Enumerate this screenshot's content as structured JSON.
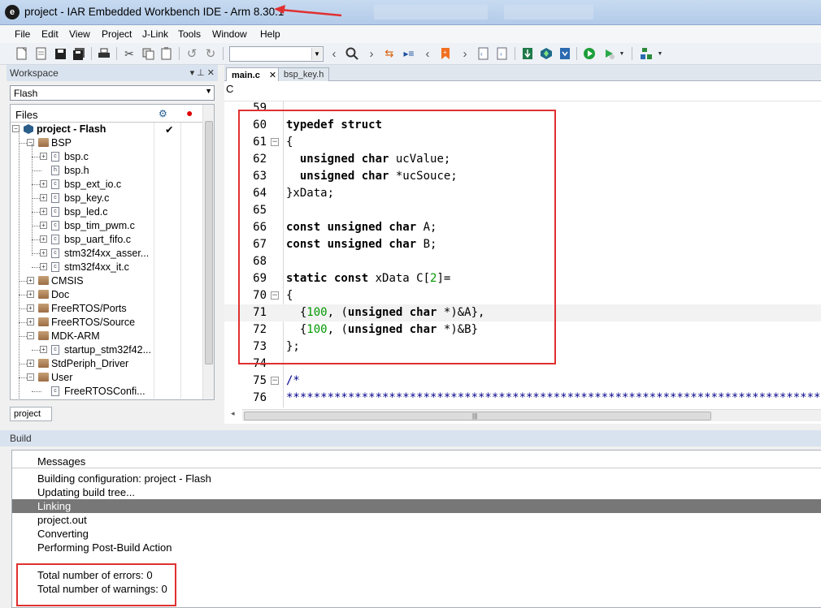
{
  "window": {
    "title": "project - IAR Embedded Workbench IDE - Arm 8.30.1",
    "icon_letter": "e"
  },
  "menu": [
    "File",
    "Edit",
    "View",
    "Project",
    "J-Link",
    "Tools",
    "Window",
    "Help"
  ],
  "toolbar": {
    "icons": [
      "new-file",
      "open",
      "save",
      "save-all",
      "print",
      "cut",
      "copy",
      "paste",
      "undo",
      "redo",
      "find",
      "bookmark",
      "compile",
      "make",
      "debug",
      "run"
    ],
    "search_value": ""
  },
  "workspace": {
    "title": "Workspace",
    "header_icons": "▾ ⊥ ✕",
    "configuration": "Flash",
    "files_header": "Files",
    "tab": "project",
    "tree": [
      {
        "label": "project - Flash",
        "level": 0,
        "kind": "project",
        "bold": true,
        "check": "✔"
      },
      {
        "label": "BSP",
        "level": 1,
        "kind": "folder",
        "exp": "−"
      },
      {
        "label": "bsp.c",
        "level": 2,
        "kind": "file",
        "exp": "+"
      },
      {
        "label": "bsp.h",
        "level": 2,
        "kind": "file",
        "exp": ""
      },
      {
        "label": "bsp_ext_io.c",
        "level": 2,
        "kind": "file",
        "exp": "+"
      },
      {
        "label": "bsp_key.c",
        "level": 2,
        "kind": "file",
        "exp": "+"
      },
      {
        "label": "bsp_led.c",
        "level": 2,
        "kind": "file",
        "exp": "+"
      },
      {
        "label": "bsp_tim_pwm.c",
        "level": 2,
        "kind": "file",
        "exp": "+"
      },
      {
        "label": "bsp_uart_fifo.c",
        "level": 2,
        "kind": "file",
        "exp": "+"
      },
      {
        "label": "stm32f4xx_asser...",
        "level": 2,
        "kind": "file",
        "exp": "+"
      },
      {
        "label": "stm32f4xx_it.c",
        "level": 2,
        "kind": "file",
        "exp": "+"
      },
      {
        "label": "CMSIS",
        "level": 1,
        "kind": "folder",
        "exp": "+"
      },
      {
        "label": "Doc",
        "level": 1,
        "kind": "folder",
        "exp": "+"
      },
      {
        "label": "FreeRTOS/Ports",
        "level": 1,
        "kind": "folder",
        "exp": "+"
      },
      {
        "label": "FreeRTOS/Source",
        "level": 1,
        "kind": "folder",
        "exp": "+"
      },
      {
        "label": "MDK-ARM",
        "level": 1,
        "kind": "folder",
        "exp": "−"
      },
      {
        "label": "startup_stm32f42...",
        "level": 2,
        "kind": "file",
        "exp": "+"
      },
      {
        "label": "StdPeriph_Driver",
        "level": 1,
        "kind": "folder",
        "exp": "+"
      },
      {
        "label": "User",
        "level": 1,
        "kind": "folder",
        "exp": "−"
      },
      {
        "label": "FreeRTOSConfi...",
        "level": 2,
        "kind": "file",
        "exp": ""
      }
    ]
  },
  "editor": {
    "tabs": [
      {
        "label": "main.c",
        "close": "✕"
      },
      {
        "label": "bsp_key.h",
        "close": ""
      }
    ],
    "breadcrumb": "C",
    "lines": [
      {
        "n": "59",
        "fold": "",
        "tokens": []
      },
      {
        "n": "60",
        "fold": "",
        "tokens": [
          {
            "t": "typedef struct",
            "c": "kw"
          }
        ]
      },
      {
        "n": "61",
        "fold": "−",
        "tokens": [
          {
            "t": "{",
            "c": ""
          }
        ]
      },
      {
        "n": "62",
        "fold": "",
        "tokens": [
          {
            "t": "  ",
            "c": ""
          },
          {
            "t": "unsigned char",
            "c": "kw"
          },
          {
            "t": " ucValue;",
            "c": ""
          }
        ]
      },
      {
        "n": "63",
        "fold": "",
        "tokens": [
          {
            "t": "  ",
            "c": ""
          },
          {
            "t": "unsigned char",
            "c": "kw"
          },
          {
            "t": " *ucSouce;",
            "c": ""
          }
        ]
      },
      {
        "n": "64",
        "fold": "",
        "tokens": [
          {
            "t": "}xData;",
            "c": ""
          }
        ]
      },
      {
        "n": "65",
        "fold": "",
        "tokens": []
      },
      {
        "n": "66",
        "fold": "",
        "tokens": [
          {
            "t": "const unsigned char",
            "c": "kw"
          },
          {
            "t": " A;",
            "c": ""
          }
        ]
      },
      {
        "n": "67",
        "fold": "",
        "tokens": [
          {
            "t": "const unsigned char",
            "c": "kw"
          },
          {
            "t": " B;",
            "c": ""
          }
        ]
      },
      {
        "n": "68",
        "fold": "",
        "tokens": []
      },
      {
        "n": "69",
        "fold": "",
        "tokens": [
          {
            "t": "static const",
            "c": "kw"
          },
          {
            "t": " xData C[",
            "c": ""
          },
          {
            "t": "2",
            "c": "num"
          },
          {
            "t": "]=",
            "c": ""
          }
        ]
      },
      {
        "n": "70",
        "fold": "−",
        "tokens": [
          {
            "t": "{",
            "c": ""
          }
        ]
      },
      {
        "n": "71",
        "fold": "",
        "hl": true,
        "tokens": [
          {
            "t": "  {",
            "c": ""
          },
          {
            "t": "100",
            "c": "num"
          },
          {
            "t": ", (",
            "c": ""
          },
          {
            "t": "unsigned char",
            "c": "kw"
          },
          {
            "t": " *)&A},",
            "c": ""
          }
        ]
      },
      {
        "n": "72",
        "fold": "",
        "tokens": [
          {
            "t": "  {",
            "c": ""
          },
          {
            "t": "100",
            "c": "num"
          },
          {
            "t": ", (",
            "c": ""
          },
          {
            "t": "unsigned char",
            "c": "kw"
          },
          {
            "t": " *)&B}",
            "c": ""
          }
        ]
      },
      {
        "n": "73",
        "fold": "",
        "tokens": [
          {
            "t": "};",
            "c": ""
          }
        ]
      },
      {
        "n": "74",
        "fold": "",
        "tokens": []
      },
      {
        "n": "75",
        "fold": "−",
        "tokens": [
          {
            "t": "/*",
            "c": "cmt"
          }
        ]
      },
      {
        "n": "76",
        "fold": "",
        "tokens": [
          {
            "t": "****************************************************************************************",
            "c": "cmt"
          }
        ]
      }
    ]
  },
  "build": {
    "title": "Build",
    "column": "Messages",
    "messages": [
      {
        "text": "Building configuration: project - Flash",
        "selected": false
      },
      {
        "text": "Updating build tree...",
        "selected": false
      },
      {
        "text": "Linking",
        "selected": true
      },
      {
        "text": "project.out",
        "selected": false
      },
      {
        "text": "Converting",
        "selected": false
      },
      {
        "text": "Performing Post-Build Action",
        "selected": false
      },
      {
        "text": "",
        "selected": false
      },
      {
        "text": "Total number of errors: 0",
        "selected": false
      },
      {
        "text": "Total number of warnings: 0",
        "selected": false
      }
    ]
  },
  "colors": {
    "annotation": "#e03030",
    "keyword": "#000000",
    "number": "#009900",
    "comment": "#00008b",
    "selection": "#777777"
  }
}
